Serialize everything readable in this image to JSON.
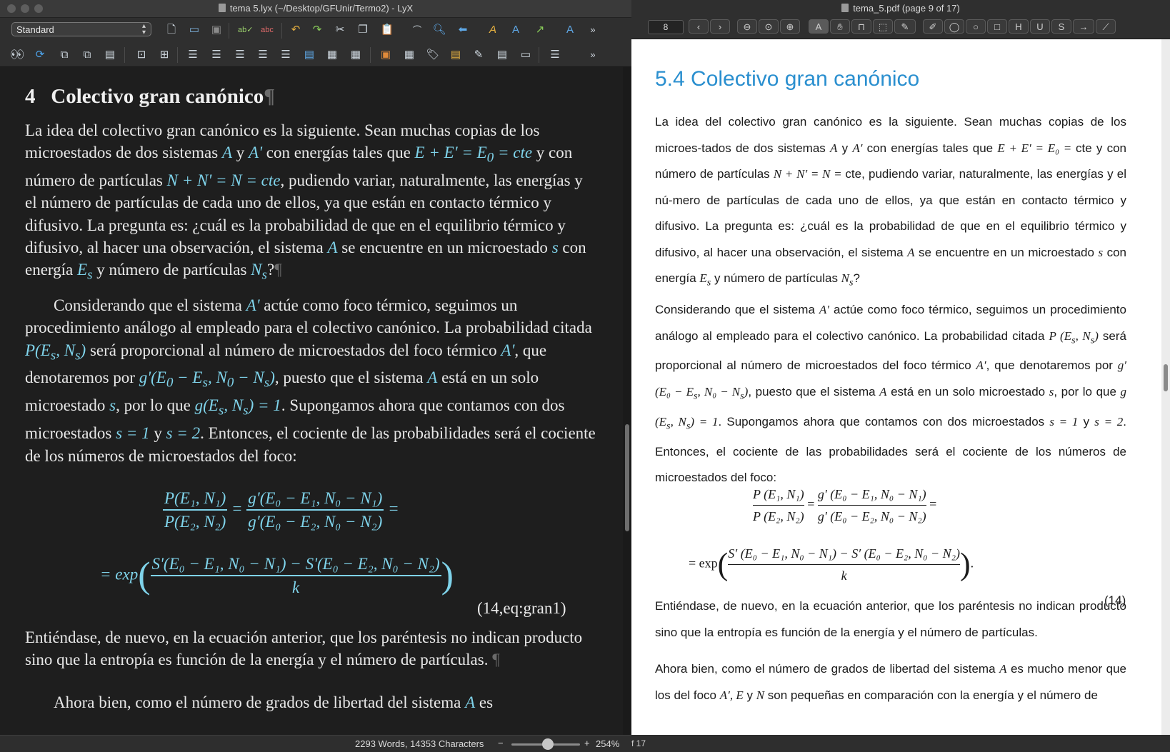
{
  "lyx": {
    "window_title": "tema 5.lyx (~/Desktop/GFUnir/Termo2) - LyX",
    "layout_select": "Standard",
    "toolbar_icons": [
      "new-document-icon",
      "open-folder-icon",
      "save-icon",
      "spellcheck-icon",
      "spellcheck-continuous-icon",
      "undo-icon",
      "redo-icon",
      "cut-icon",
      "copy-icon",
      "paste-icon",
      "find-replace-icon",
      "search-icon",
      "back-icon",
      "text-style-icon",
      "text-style-2-icon",
      "math-icon",
      "format-icon"
    ],
    "toolbar2_icons": [
      "view-icon",
      "refresh-icon",
      "view-other-icon",
      "update-icon",
      "export-icon",
      "toggle-view-icon",
      "toc-icon",
      "list-icon",
      "enumerate-icon",
      "description-icon",
      "list-2-icon",
      "list-3-icon",
      "section-icon",
      "citation-icon",
      "insert-icon",
      "insert-graphics-icon",
      "insert-table-icon",
      "label-icon",
      "insert-box-icon",
      "insert-note-icon",
      "insert-float-icon",
      "insert-code-icon",
      "toolbar-more-icon"
    ],
    "section_number": "4",
    "section_title": "Colectivo gran canónico",
    "pilcrow": "¶",
    "p1": {
      "a": "La idea del colectivo gran canónico es la siguiente. Sean muchas copias de los microestados de dos sistemas ",
      "m1": "A",
      "b": " y ",
      "m2": "A'",
      "c": " con energías tales que ",
      "m3": "E + E' = E",
      "m3sub": "0",
      "m3rest": " = cte",
      "d": " y con número de partículas ",
      "m4": "N + N' = N = cte",
      "e": ", pudiendo variar, naturalmente, las energías y el número de partículas de cada uno de ellos, ya que están en contacto térmico y difusivo. La pregunta es: ¿cuál es la probabilidad de que en el equilibrio térmico y difusivo, al hacer una observación, el sistema ",
      "m5": "A",
      "f": " se encuentre en un microestado ",
      "m6": "s",
      "g": " con energía ",
      "m7": "E",
      "m7sub": "s",
      "h": " y número de partículas ",
      "m8": "N",
      "m8sub": "s",
      "i": "?"
    },
    "p2": {
      "a": "Considerando que el sistema ",
      "m1": "A'",
      "b": " actúe como foco térmico, seguimos un procedimiento análogo al empleado para el colectivo canónico. La probabilidad citada ",
      "m2": "P(E",
      "m2sub1": "s",
      "m2mid": ", N",
      "m2sub2": "s",
      "m2end": ")",
      "c": " será proporcional al número de microestados del foco térmico ",
      "m3": "A'",
      "d": ", que denotaremos por ",
      "m4": "g'(E",
      "m4s1": "0",
      "m4a": " − E",
      "m4s2": "s",
      "m4b": ", N",
      "m4s3": "0",
      "m4c": " − N",
      "m4s4": "s",
      "m4d": ")",
      "e": ", puesto que el sistema ",
      "m5": "A",
      "f": " está en un solo microestado ",
      "m6": "s",
      "g": ", por lo que ",
      "m7": "g(E",
      "m7s1": "s",
      "m7a": ", N",
      "m7s2": "s",
      "m7b": ") = 1",
      "h": ". Supongamos ahora que contamos con dos microestados ",
      "m8": "s = 1",
      "i": " y ",
      "m9": "s = 2",
      "j": ". Entonces, el cociente de las probabilidades será el cociente de los números de microestados del foco:"
    },
    "eq1": {
      "lhs_num": "P(E₁, N₁)",
      "lhs_den": "P(E₂, N₂)",
      "rhs_num": "g'(E₀ − E₁, N₀ − N₁)",
      "rhs_den": "g'(E₀ − E₂, N₀ − N₂)",
      "tail": "="
    },
    "eq2": {
      "lead": "= exp",
      "num": "S'(E₀ − E₁, N₀ − N₁) − S'(E₀ − E₂, N₀ − N₂)",
      "den": "k"
    },
    "eq_label": "(14,eq:gran1)",
    "p3": "Entiéndase, de nuevo, en la ecuación anterior, que los paréntesis no indican producto sino que la entropía es función de la energía y el número de partículas. ",
    "p4_cut": "Ahora bien, como el número de grados de libertad del sistema ",
    "p4_m": "A",
    "p4_end": " es",
    "status_words": "2293 Words, 14353 Characters",
    "zoom_minus": "−",
    "zoom_plus": "+",
    "zoom_value": "254%",
    "zoom_level": 0.53
  },
  "pdf": {
    "window_title": "tema_5.pdf (page 9 of 17)",
    "page_field": "8",
    "heading": "5.4  Colectivo gran canónico",
    "p1": {
      "a": "La idea del colectivo gran canónico es la siguiente. Sean muchas copias de los microes-tados de dos sistemas ",
      "m1": "A",
      "b": " y ",
      "m2": "A′",
      "c": " con energías tales que ",
      "m3": "E + E′ = E₀ = ",
      "m3r": "cte",
      "d": " y con número de partículas ",
      "m4": "N + N′ = N = ",
      "m4r": "cte",
      "e": ", pudiendo variar, naturalmente, las energías y el nú-mero de partículas de cada uno de ellos, ya que están en contacto térmico y difusivo. La pregunta es: ¿cuál es la probabilidad de que en el equilibrio térmico y difusivo, al hacer una observación, el sistema ",
      "m5": "A",
      "f": " se encuentre en un microestado ",
      "m6": "s",
      "g": " con energía ",
      "m7": "E",
      "m7sub": "s",
      "h": " y número de partículas ",
      "m8": "N",
      "m8sub": "s",
      "i": "?"
    },
    "p2": {
      "a": "Considerando que el sistema ",
      "m1": "A′",
      "b": " actúe como foco térmico, seguimos un procedimiento análogo al empleado para el colectivo canónico. La probabilidad citada ",
      "m2": "P (E",
      "m2s1": "s",
      "m2a": ", N",
      "m2s2": "s",
      "m2b": ")",
      "c": " será proporcional al número de microestados del foco térmico ",
      "m3": "A′",
      "d": ", que denotaremos por ",
      "m4": "g′ (E₀ − E",
      "m4s1": "s",
      "m4a": ", N₀ − N",
      "m4s2": "s",
      "m4b": ")",
      "e": ", puesto que el sistema ",
      "m5": "A",
      "f": " está en un solo microestado ",
      "m6": "s",
      "g": ", por lo que ",
      "m7": "g (E",
      "m7s1": "s",
      "m7a": ", N",
      "m7s2": "s",
      "m7b": ") = 1",
      "h": ". Supongamos ahora que contamos con dos microestados ",
      "m8": "s = 1",
      "i": " y ",
      "m9": "s = 2",
      "j": ". Entonces, el cociente de las probabilidades será el cociente de los números de microestados del foco:"
    },
    "eq1": {
      "lhs_num": "P (E₁, N₁)",
      "lhs_den": "P (E₂, N₂)",
      "rhs_num": "g′ (E₀ − E₁, N₀ − N₁)",
      "rhs_den": "g′ (E₀ − E₂, N₀ − N₂)",
      "tail": "="
    },
    "eq2": {
      "lead": "= exp",
      "num": "S′ (E₀ − E₁, N₀ − N₁) − S′ (E₀ − E₂, N₀ − N₂)",
      "den": "k",
      "tail": "."
    },
    "eq_number": "(14)",
    "p3": "Entiéndase, de nuevo, en la ecuación anterior, que los paréntesis no indican producto sino que la entropía es función de la energía y el número de partículas.",
    "p4": "Ahora bien, como el número de grados de libertad del sistema ",
    "p4m": "A",
    "p4b": " es mucho menor que los del foco ",
    "p4m2": "A′, E",
    "p4c": " y ",
    "p4m3": "N",
    "p4d": " son pequeñas en comparación con la energía y el número de",
    "status": "f 17"
  }
}
